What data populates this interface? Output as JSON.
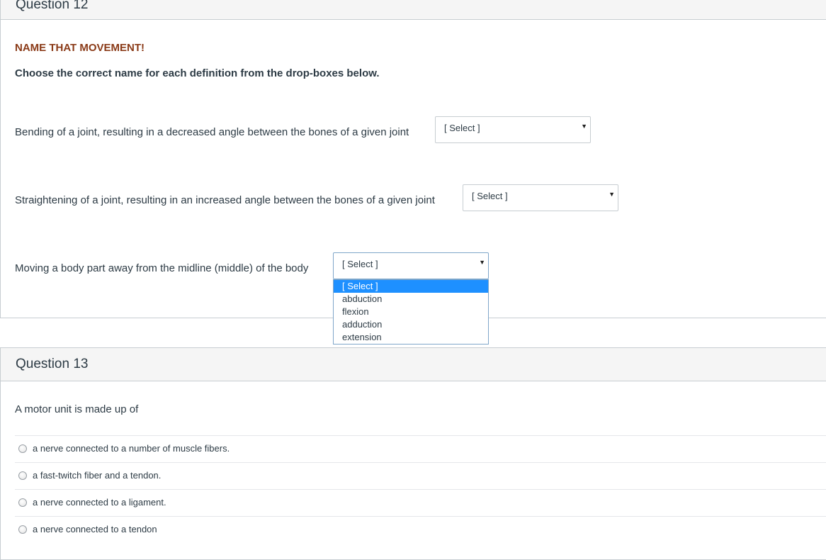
{
  "q12": {
    "title": "Question 12",
    "heading": "NAME THAT MOVEMENT!",
    "instruction": "Choose the correct name for each definition from the drop-boxes below.",
    "items": [
      {
        "stem": "Bending of a joint, resulting in a decreased angle between the bones of a given joint",
        "selected": "[ Select ]"
      },
      {
        "stem": "Straightening of a joint, resulting in an increased angle between the bones of a given joint",
        "selected": "[ Select ]"
      },
      {
        "stem": "Moving a body part away from the midline (middle) of the body",
        "selected": "[ Select ]"
      }
    ],
    "dropdown_options": [
      "[ Select ]",
      "abduction",
      "flexion",
      "adduction",
      "extension"
    ],
    "highlighted_option": "[ Select ]"
  },
  "q13": {
    "title": "Question 13",
    "stem": "A motor unit is made up of",
    "answers": [
      "a nerve connected to a number of muscle fibers.",
      "a fast-twitch fiber and a tendon.",
      "a nerve connected to a ligament.",
      "a nerve connected to a tendon"
    ]
  },
  "icons": {
    "caret": "caret-down-icon",
    "radio": "radio-button-icon"
  },
  "colors": {
    "heading": "#8a3a17",
    "highlight": "#1e90ff",
    "text": "#2d3b45"
  }
}
